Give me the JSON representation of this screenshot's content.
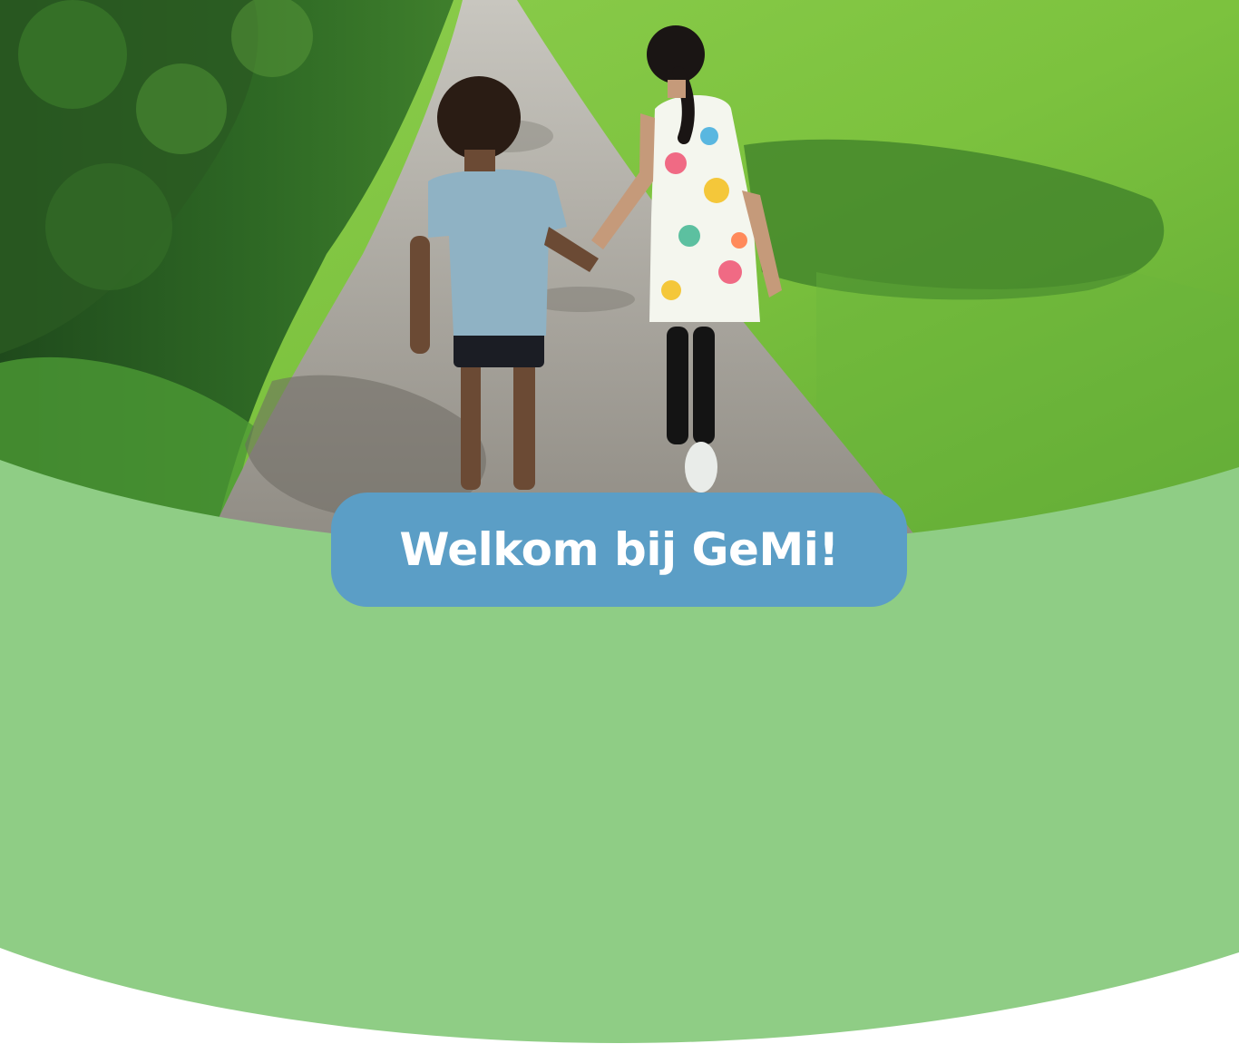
{
  "hero": {
    "image": "children-walking-hand-in-hand-on-country-path",
    "welcome_text": "Welkom bij GeMi!"
  },
  "colors": {
    "panel_green": "#8fcd85",
    "pill_blue": "#5b9ec6",
    "page_white": "#ffffff",
    "title_text": "#ffffff"
  }
}
